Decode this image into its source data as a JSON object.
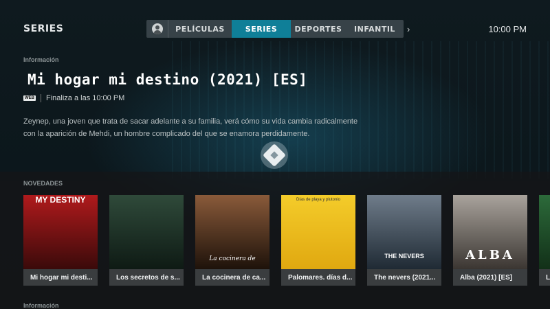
{
  "header": {
    "section": "SERIES",
    "clock": "10:00 PM",
    "menu": [
      "PELÍCULAS",
      "SERIES",
      "DEPORTES",
      "INFANTIL"
    ],
    "active_index": 1
  },
  "info": {
    "label": "Información",
    "title": "Mi hogar mi destino (2021) [ES]",
    "badge": "WEB",
    "ends_at": "Finaliza a las 10:00 PM",
    "description": "Zeynep, una joven que trata de sacar adelante a su familia, verá cómo su vida cambia radicalmente con la aparición de Mehdi, un hombre complicado del que se enamora perdidamente."
  },
  "shelf": {
    "label": "NOVEDADES",
    "items": [
      {
        "caption": "Mi hogar mi desti...",
        "poster_text": "MY DESTINY",
        "colors": [
          "#b01a1c",
          "#3a0a0a"
        ]
      },
      {
        "caption": "Los secretos de s...",
        "poster_text": "",
        "colors": [
          "#2f4a3a",
          "#0e1a14"
        ]
      },
      {
        "caption": "La cocinera de ca...",
        "poster_text": "La cocinera de",
        "colors": [
          "#8a5a3a",
          "#1e120a"
        ]
      },
      {
        "caption": "Palomares. días d...",
        "poster_text": "Días de playa y plutonio",
        "colors": [
          "#f4cc2a",
          "#e0a810"
        ]
      },
      {
        "caption": "The nevers (2021...",
        "poster_text": "THE NEVERS",
        "colors": [
          "#6f7c8a",
          "#1f2a34"
        ]
      },
      {
        "caption": "Alba (2021) [ES]",
        "poster_text": "ALBA",
        "colors": [
          "#a9a39c",
          "#3b3632"
        ]
      },
      {
        "caption": "L",
        "poster_text": "",
        "colors": [
          "#2c6a3a",
          "#123018"
        ]
      }
    ]
  },
  "footer": {
    "label": "Información"
  }
}
